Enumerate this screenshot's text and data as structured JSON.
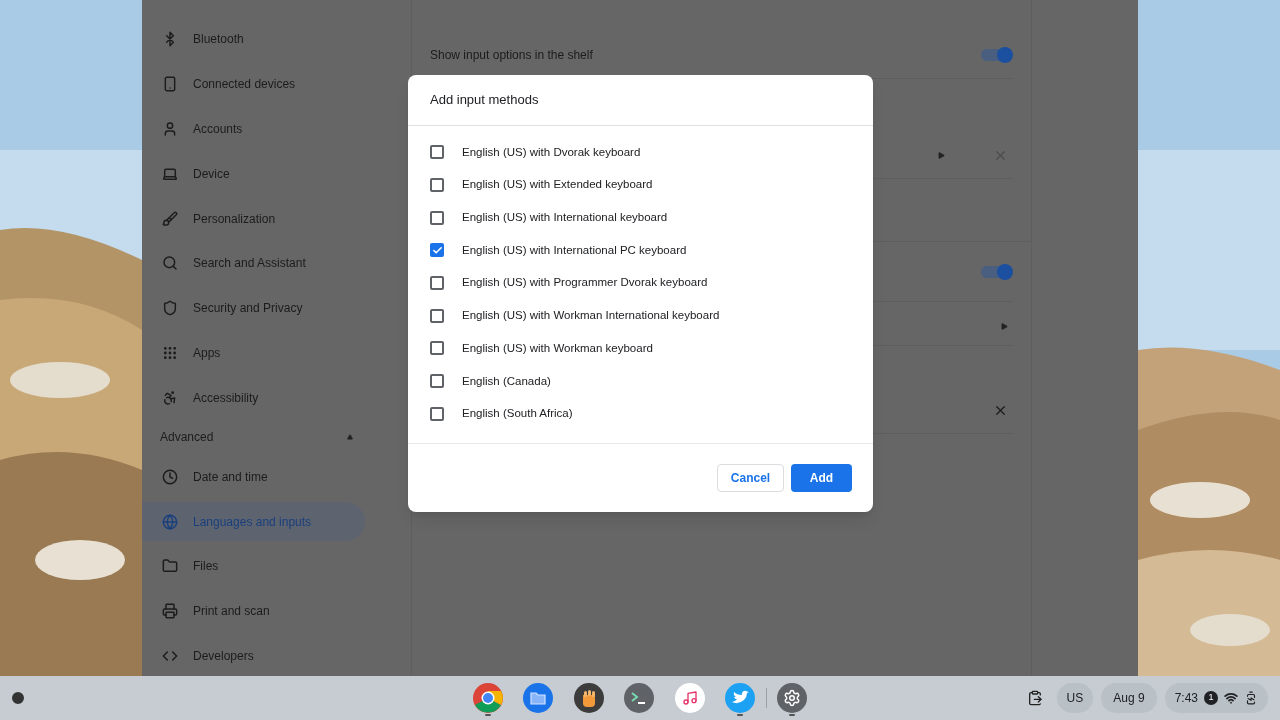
{
  "settings": {
    "sidebar": {
      "items": [
        {
          "label": "Bluetooth",
          "selected": false
        },
        {
          "label": "Connected devices",
          "selected": false
        },
        {
          "label": "Accounts",
          "selected": false
        },
        {
          "label": "Device",
          "selected": false
        },
        {
          "label": "Personalization",
          "selected": false
        },
        {
          "label": "Search and Assistant",
          "selected": false
        },
        {
          "label": "Security and Privacy",
          "selected": false
        },
        {
          "label": "Apps",
          "selected": false
        },
        {
          "label": "Accessibility",
          "selected": false
        }
      ],
      "advanced": {
        "label": "Advanced",
        "expanded": true,
        "items": [
          {
            "label": "Date and time",
            "selected": false
          },
          {
            "label": "Languages and inputs",
            "selected": true
          },
          {
            "label": "Files",
            "selected": false
          },
          {
            "label": "Print and scan",
            "selected": false
          },
          {
            "label": "Developers",
            "selected": false
          }
        ]
      }
    },
    "content": {
      "rows": [
        {
          "kind": "toggle",
          "label": "Show input options in the shelf",
          "on": true
        },
        {
          "kind": "submenu",
          "removable": true,
          "disabled": true
        },
        {
          "kind": "spacer"
        },
        {
          "kind": "toggle",
          "on": true
        },
        {
          "kind": "submenu",
          "removable": false
        },
        {
          "kind": "remove",
          "disabled": false
        }
      ]
    }
  },
  "dialog": {
    "title": "Add input methods",
    "options": [
      {
        "label": "English (US) with Dvorak keyboard",
        "checked": false
      },
      {
        "label": "English (US) with Extended keyboard",
        "checked": false
      },
      {
        "label": "English (US) with International keyboard",
        "checked": false
      },
      {
        "label": "English (US) with International PC keyboard",
        "checked": true
      },
      {
        "label": "English (US) with Programmer Dvorak keyboard",
        "checked": false
      },
      {
        "label": "English (US) with Workman International keyboard",
        "checked": false
      },
      {
        "label": "English (US) with Workman keyboard",
        "checked": false
      },
      {
        "label": "English (Canada)",
        "checked": false
      },
      {
        "label": "English (South Africa)",
        "checked": false
      }
    ],
    "buttons": [
      {
        "label": "Cancel",
        "kind": "secondary"
      },
      {
        "label": "Add",
        "kind": "primary"
      }
    ]
  },
  "shelf": {
    "apps": [
      {
        "kind": "chrome",
        "running": true
      },
      {
        "kind": "files",
        "running": false
      },
      {
        "kind": "hand",
        "running": false
      },
      {
        "kind": "terminal",
        "running": false
      },
      {
        "kind": "music",
        "running": false
      },
      {
        "kind": "bird",
        "running": true
      },
      {
        "kind": "settings",
        "running": true
      }
    ],
    "ime": "US",
    "date": "Aug 9",
    "time": "7:43",
    "notifications": "1"
  }
}
